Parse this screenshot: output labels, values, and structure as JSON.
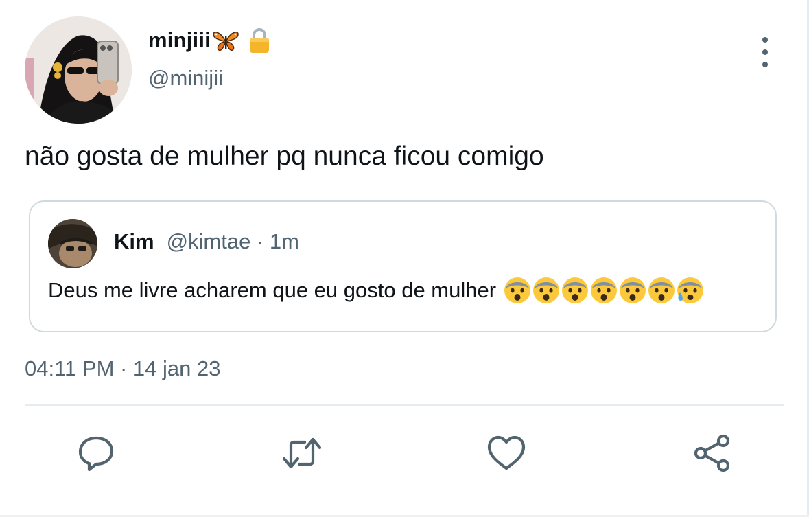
{
  "author": {
    "display_name": "minjiii",
    "handle": "@minijii",
    "name_decorations": [
      "butterfly-emoji",
      "lock-icon"
    ]
  },
  "tweet": {
    "text": "não gosta de mulher pq nunca ficou comigo"
  },
  "quoted_tweet": {
    "name": "Kim",
    "meta": "@kimtae · 1m",
    "text": "Deus me livre acharem que eu gosto de mulher",
    "emojis": [
      "fearful-face",
      "fearful-face",
      "fearful-face",
      "fearful-face",
      "fearful-face",
      "fearful-face",
      "anxious-face-with-sweat"
    ]
  },
  "timestamp": "04:11 PM · 14 jan 23",
  "actions": [
    "reply-icon",
    "retweet-icon",
    "like-icon",
    "share-icon"
  ],
  "colors": {
    "text_primary": "#0f1419",
    "text_secondary": "#536471",
    "border": "#cfd9de",
    "lock": "#f5b52a",
    "emoji_face": "#fbc93b"
  }
}
